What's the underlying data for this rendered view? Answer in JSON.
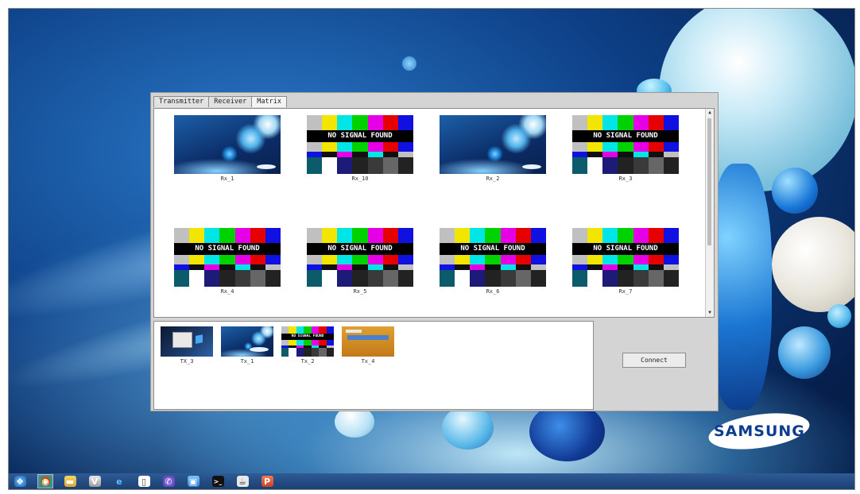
{
  "window": {
    "tabs": [
      {
        "label": "Transmitter"
      },
      {
        "label": "Receiver"
      },
      {
        "label": "Matrix"
      }
    ],
    "active_tab": "Matrix",
    "receivers": [
      {
        "label": "Rx_1",
        "content": "desktop"
      },
      {
        "label": "Rx_10",
        "content": "NO SIGNAL FOUND"
      },
      {
        "label": "Rx_2",
        "content": "desktop"
      },
      {
        "label": "Rx_3",
        "content": "NO SIGNAL FOUND"
      },
      {
        "label": "Rx_4",
        "content": "NO SIGNAL FOUND"
      },
      {
        "label": "Rx_5",
        "content": "NO SIGNAL FOUND"
      },
      {
        "label": "Rx_6",
        "content": "NO SIGNAL FOUND"
      },
      {
        "label": "Rx_7",
        "content": "NO SIGNAL FOUND"
      }
    ],
    "transmitters": [
      {
        "label": "TX_3",
        "content": "windows-desktop"
      },
      {
        "label": "Tx_1",
        "content": "desktop"
      },
      {
        "label": "Tx_2",
        "content": "NO SIGNAL FOUND"
      },
      {
        "label": "Tx_4",
        "content": "orange-app"
      }
    ],
    "no_signal_text": "NO SIGNAL FOUND",
    "connect_label": "Connect"
  },
  "desktop": {
    "brand": "SAMSUNG"
  },
  "taskbar": {
    "icons": [
      "start-orb-icon",
      "chrome-icon",
      "file-explorer-icon",
      "vnc-icon",
      "internet-explorer-icon",
      "document-icon",
      "viber-icon",
      "remote-desktop-icon",
      "terminal-icon",
      "java-icon",
      "powerpoint-icon"
    ]
  },
  "colors": {
    "bars_top": [
      "#c0c0c0",
      "#f2e500",
      "#00e5e5",
      "#00d200",
      "#e600e6",
      "#e60000",
      "#1010e0"
    ],
    "bars_mid": [
      "#1010e0",
      "#101010",
      "#e600e6",
      "#101010",
      "#00e5e5",
      "#101010",
      "#c0c0c0"
    ],
    "bars_bottom": [
      "#0c5b6a",
      "#ffffff",
      "#1c1c78",
      "#222222",
      "#3a3a3a",
      "#666666",
      "#222222"
    ]
  }
}
